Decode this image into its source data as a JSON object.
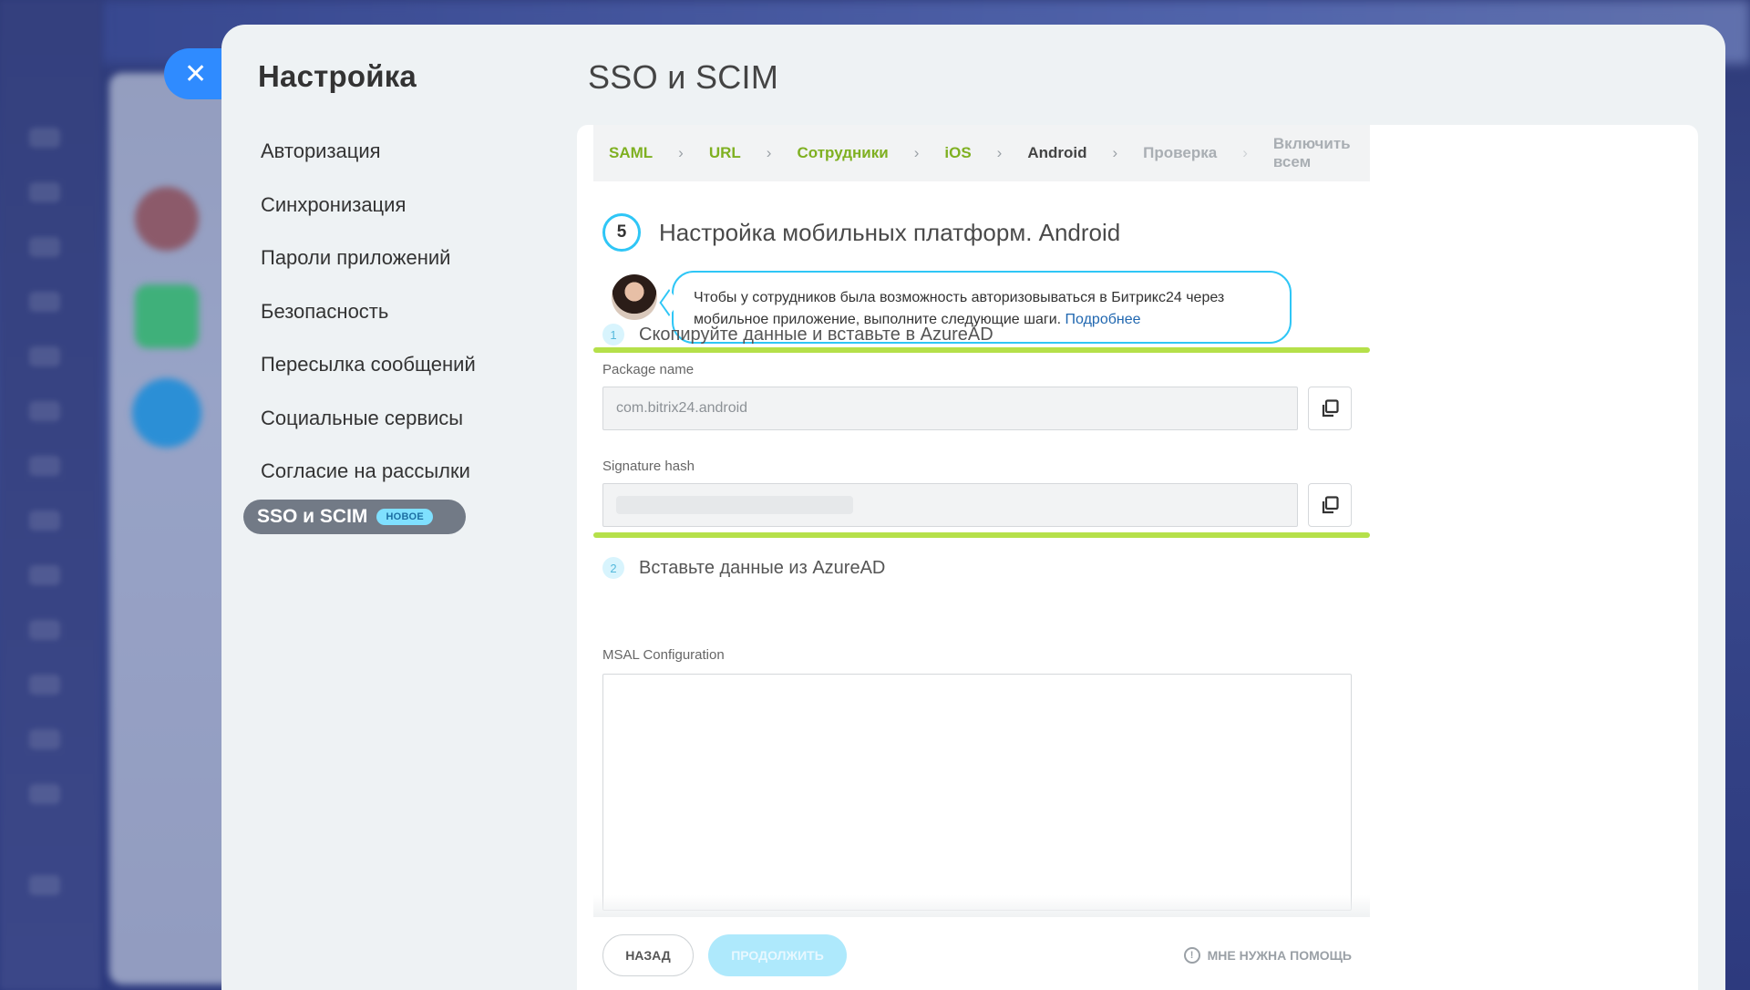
{
  "close": {
    "icon": "close-icon",
    "glyph": "✕"
  },
  "settings": {
    "title": "Настройка",
    "menu": [
      {
        "label": "Авторизация"
      },
      {
        "label": "Синхронизация"
      },
      {
        "label": "Пароли приложений"
      },
      {
        "label": "Безопасность"
      },
      {
        "label": "Пересылка сообщений"
      },
      {
        "label": "Социальные сервисы"
      },
      {
        "label": "Согласие на рассылки"
      }
    ],
    "active": {
      "label": "SSO и SCIM",
      "badge": "НОВОЕ"
    }
  },
  "page": {
    "title": "SSO и SCIM"
  },
  "wizard": {
    "steps": [
      {
        "label": "SAML",
        "state": "done"
      },
      {
        "label": "URL",
        "state": "done"
      },
      {
        "label": "Сотрудники",
        "state": "done"
      },
      {
        "label": "iOS",
        "state": "done"
      },
      {
        "label": "Android",
        "state": "current"
      },
      {
        "label": "Проверка",
        "state": "todo"
      },
      {
        "label": "Включить всем",
        "state": "todo"
      }
    ],
    "step_number": "5",
    "step_title": "Настройка мобильных платформ. Android",
    "tip": {
      "text": "Чтобы у сотрудников была возможность авторизовываться в Битрикс24 через мобильное приложение, выполните следующие шаги. ",
      "link": "Подробнее"
    },
    "section1": {
      "number": "1",
      "title": "Скопируйте данные и вставьте в AzureAD"
    },
    "package_name": {
      "label": "Package name",
      "value": "com.bitrix24.android"
    },
    "signature_hash": {
      "label": "Signature hash"
    },
    "section2": {
      "number": "2",
      "title": "Вставьте данные из AzureAD"
    },
    "msal": {
      "label": "MSAL Configuration"
    },
    "buttons": {
      "back": "НАЗАД",
      "next": "ПРОДОЛЖИТЬ",
      "help": "МНЕ НУЖНА ПОМОЩЬ"
    }
  },
  "colors": {
    "accent": "#2fc6f6",
    "done": "#7fb021",
    "highlight": "#b5e04a",
    "close": "#2f8bff"
  }
}
